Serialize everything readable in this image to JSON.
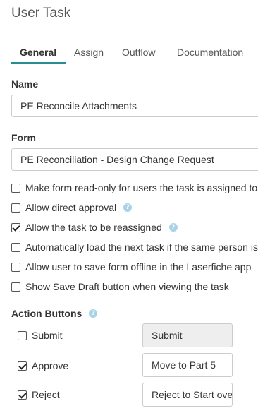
{
  "header": {
    "title": "User Task"
  },
  "tabs": [
    {
      "label": "General",
      "active": true
    },
    {
      "label": "Assign",
      "active": false
    },
    {
      "label": "Outflow",
      "active": false
    },
    {
      "label": "Documentation",
      "active": false
    }
  ],
  "name_field": {
    "label": "Name",
    "value": "PE Reconcile Attachments"
  },
  "form_field": {
    "label": "Form",
    "value": "PE Reconciliation - Design Change Request"
  },
  "options": [
    {
      "label": "Make form read-only for users the task is assigned to",
      "checked": false,
      "help": false
    },
    {
      "label": "Allow direct approval",
      "checked": false,
      "help": true
    },
    {
      "label": "Allow the task to be reassigned",
      "checked": true,
      "help": true
    },
    {
      "label": "Automatically load the next task if the same person is assigned",
      "checked": false,
      "help": false
    },
    {
      "label": "Allow user to save form offline in the Laserfiche app",
      "checked": false,
      "help": false
    },
    {
      "label": "Show Save Draft button when viewing the task",
      "checked": false,
      "help": false
    }
  ],
  "action_buttons": {
    "label": "Action Buttons",
    "help_icon": "?",
    "items": [
      {
        "label": "Submit",
        "checked": false,
        "button_text": "Submit",
        "disabled": true
      },
      {
        "label": "Approve",
        "checked": true,
        "button_text": "Move to Part 5",
        "disabled": false
      },
      {
        "label": "Reject",
        "checked": true,
        "button_text": "Reject to Start over",
        "disabled": false
      }
    ]
  },
  "colors": {
    "accent": "#2a8c93",
    "help_icon": "#a9d2e6",
    "disabled_bg": "#eeeeee"
  }
}
